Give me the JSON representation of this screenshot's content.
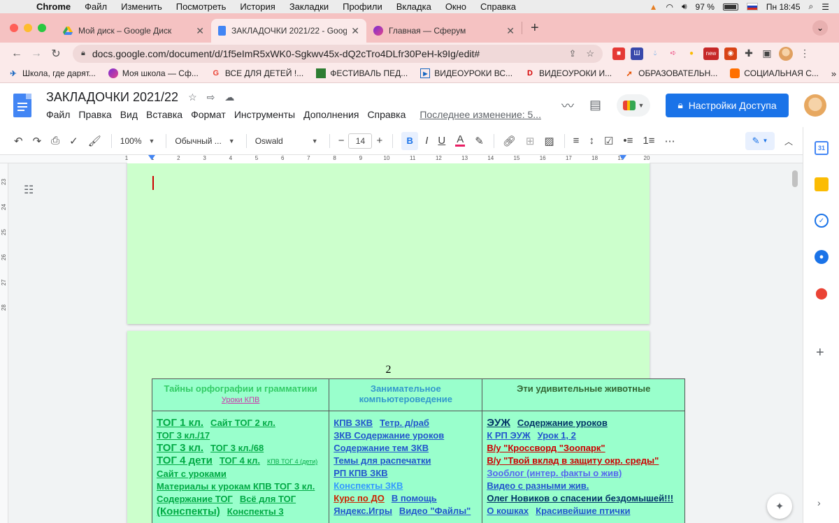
{
  "menubar": {
    "apple": "",
    "app": "Chrome",
    "items": [
      "Файл",
      "Изменить",
      "Посмотреть",
      "История",
      "Закладки",
      "Профили",
      "Вкладка",
      "Окно",
      "Справка"
    ],
    "battery": "97 %",
    "clock": "Пн 18:45"
  },
  "tabs": [
    {
      "title": "Мой диск – Google Диск",
      "active": false
    },
    {
      "title": "ЗАКЛАДОЧКИ 2021/22 - Goog",
      "active": true
    },
    {
      "title": "Главная — Сферум",
      "active": false
    }
  ],
  "omnibox": {
    "url": "docs.google.com/document/d/1f5eImR5xWK0-Sgkwv45x-dQ2cTro4DLfr30PeH-k9Ig/edit#"
  },
  "extensions": {
    "new_badge": "new"
  },
  "bookmarks": [
    {
      "label": "Школа, где дарят...",
      "icon": "school-bookmark-icon"
    },
    {
      "label": "Моя школа — Сф...",
      "icon": "sferum-bookmark-icon"
    },
    {
      "label": "ВСЕ ДЛЯ ДЕТЕЙ !...",
      "icon": "google-bookmark-icon"
    },
    {
      "label": "ФЕСТИВАЛЬ ПЕД...",
      "icon": "festival-bookmark-icon"
    },
    {
      "label": "ВИДЕОУРОКИ ВС...",
      "icon": "video-bookmark-icon"
    },
    {
      "label": "ВИДЕОУРОКИ И...",
      "icon": "video-red-bookmark-icon"
    },
    {
      "label": "ОБРАЗОВАТЕЛЬН...",
      "icon": "edu-bookmark-icon"
    },
    {
      "label": "СОЦИАЛЬНАЯ С...",
      "icon": "social-bookmark-icon"
    }
  ],
  "bookmarks_more": "»",
  "docs": {
    "title": "ЗАКЛАДОЧКИ 2021/22",
    "menu": [
      "Файл",
      "Правка",
      "Вид",
      "Вставка",
      "Формат",
      "Инструменты",
      "Дополнения",
      "Справка"
    ],
    "last_edit": "Последнее изменение: 5...",
    "share_label": "Настройки Доступа"
  },
  "toolbar": {
    "zoom": "100%",
    "style": "Обычный ...",
    "font": "Oswald",
    "font_size": "14",
    "bold": "B",
    "italic": "I",
    "underline": "U",
    "text_color": "A",
    "more": "⋯"
  },
  "ruler": {
    "numbers": [
      "1",
      "1",
      "2",
      "3",
      "4",
      "5",
      "6",
      "7",
      "8",
      "9",
      "10",
      "11",
      "12",
      "13",
      "14",
      "15",
      "16",
      "17",
      "18",
      "19",
      "20"
    ]
  },
  "vruler": {
    "numbers": [
      "23",
      "24",
      "25",
      "26",
      "27",
      "28"
    ]
  },
  "page2": {
    "number": "2",
    "headers": [
      {
        "title": "Тайны орфографии и грамматики",
        "sub": "Уроки КПВ"
      },
      {
        "title": "Занимательное компьютероведение"
      },
      {
        "title": "Эти удивительные животные"
      }
    ],
    "col1": [
      [
        {
          "t": "ТОГ 1 кл.",
          "c": "#00aa44",
          "s": "big"
        },
        {
          "t": "Сайт ТОГ 2 кл.",
          "c": "#00aa44"
        }
      ],
      [
        {
          "t": "ТОГ 3 кл./17",
          "c": "#00aa44"
        }
      ],
      [
        {
          "t": "ТОГ 3 кл.",
          "c": "#00aa44",
          "s": "big"
        },
        {
          "t": "ТОГ 3 кл./68",
          "c": "#00aa44"
        }
      ],
      [
        {
          "t": "ТОГ 4 дети",
          "c": "#00aa44",
          "s": "big"
        },
        {
          "t": "ТОГ 4 кл.",
          "c": "#00aa44"
        },
        {
          "t": "КПВ ТОГ 4 (дети)",
          "c": "#00aa44",
          "s": "small"
        }
      ],
      [
        {
          "t": "Сайт с уроками",
          "c": "#00aa44"
        }
      ],
      [
        {
          "t": "Материалы к урокам КПВ ТОГ 3 кл.",
          "c": "#00aa44"
        }
      ],
      [
        {
          "t": "Содержание ТОГ",
          "c": "#00aa44"
        },
        {
          "t": "Всё для ТОГ",
          "c": "#00aa44"
        }
      ],
      [
        {
          "t": "(Конспекты)",
          "c": "#00aa44",
          "s": "big"
        },
        {
          "t": "Конспекты 3",
          "c": "#00aa44"
        }
      ]
    ],
    "col2": [
      [
        {
          "t": "КПВ ЗКВ",
          "c": "#2255cc"
        },
        {
          "t": "Тетр. д/раб",
          "c": "#2255cc"
        }
      ],
      [
        {
          "t": "ЗКВ Содержание уроков",
          "c": "#2255cc"
        }
      ],
      [
        {
          "t": "Содержание тем ЗКВ",
          "c": "#2255cc"
        }
      ],
      [
        {
          "t": "Темы для распечатки",
          "c": "#2255cc"
        }
      ],
      [
        {
          "t": "РП КПВ ЗКВ",
          "c": "#2255cc"
        }
      ],
      [
        {
          "t": "Конспекты ЗКВ",
          "c": "#3399ff"
        }
      ],
      [
        {
          "t": "Курс по ДО",
          "c": "#cc2200"
        },
        {
          "t": "В помощь",
          "c": "#2255cc"
        }
      ],
      [
        {
          "t": "Яндекс.Игры",
          "c": "#2255cc"
        },
        {
          "t": "Видео \"Файлы\"",
          "c": "#2255cc"
        }
      ]
    ],
    "col3": [
      [
        {
          "t": "ЭУЖ",
          "c": "#003366",
          "s": "big"
        },
        {
          "t": "Содержание уроков",
          "c": "#003366"
        }
      ],
      [
        {
          "t": "К РП ЭУЖ",
          "c": "#2255cc"
        },
        {
          "t": "Урок 1, 2",
          "c": "#2255cc"
        }
      ],
      [
        {
          "t": "В/у \"Кроссворд \"Зоопарк\"",
          "c": "#cc0000"
        }
      ],
      [
        {
          "t": "В/у \"Твой вклад в защиту окр. среды\"",
          "c": "#cc0000"
        }
      ],
      [
        {
          "t": "Зооблог (интер. факты о жив)",
          "c": "#5566ee"
        }
      ],
      [
        {
          "t": "Видео с разными жив.",
          "c": "#2255cc"
        }
      ],
      [
        {
          "t": "Олег Новиков о спасении бездомышей!!!",
          "c": "#003366"
        }
      ],
      [
        {
          "t": "О кошках",
          "c": "#2255cc"
        },
        {
          "t": "Красивейшие птички",
          "c": "#2255cc"
        }
      ]
    ]
  },
  "colors": {
    "page_bg": "#ccffcc",
    "table_bg": "#99ffcc",
    "tabstrip_bg": "#f5c2c2",
    "share_blue": "#1a73e8"
  }
}
